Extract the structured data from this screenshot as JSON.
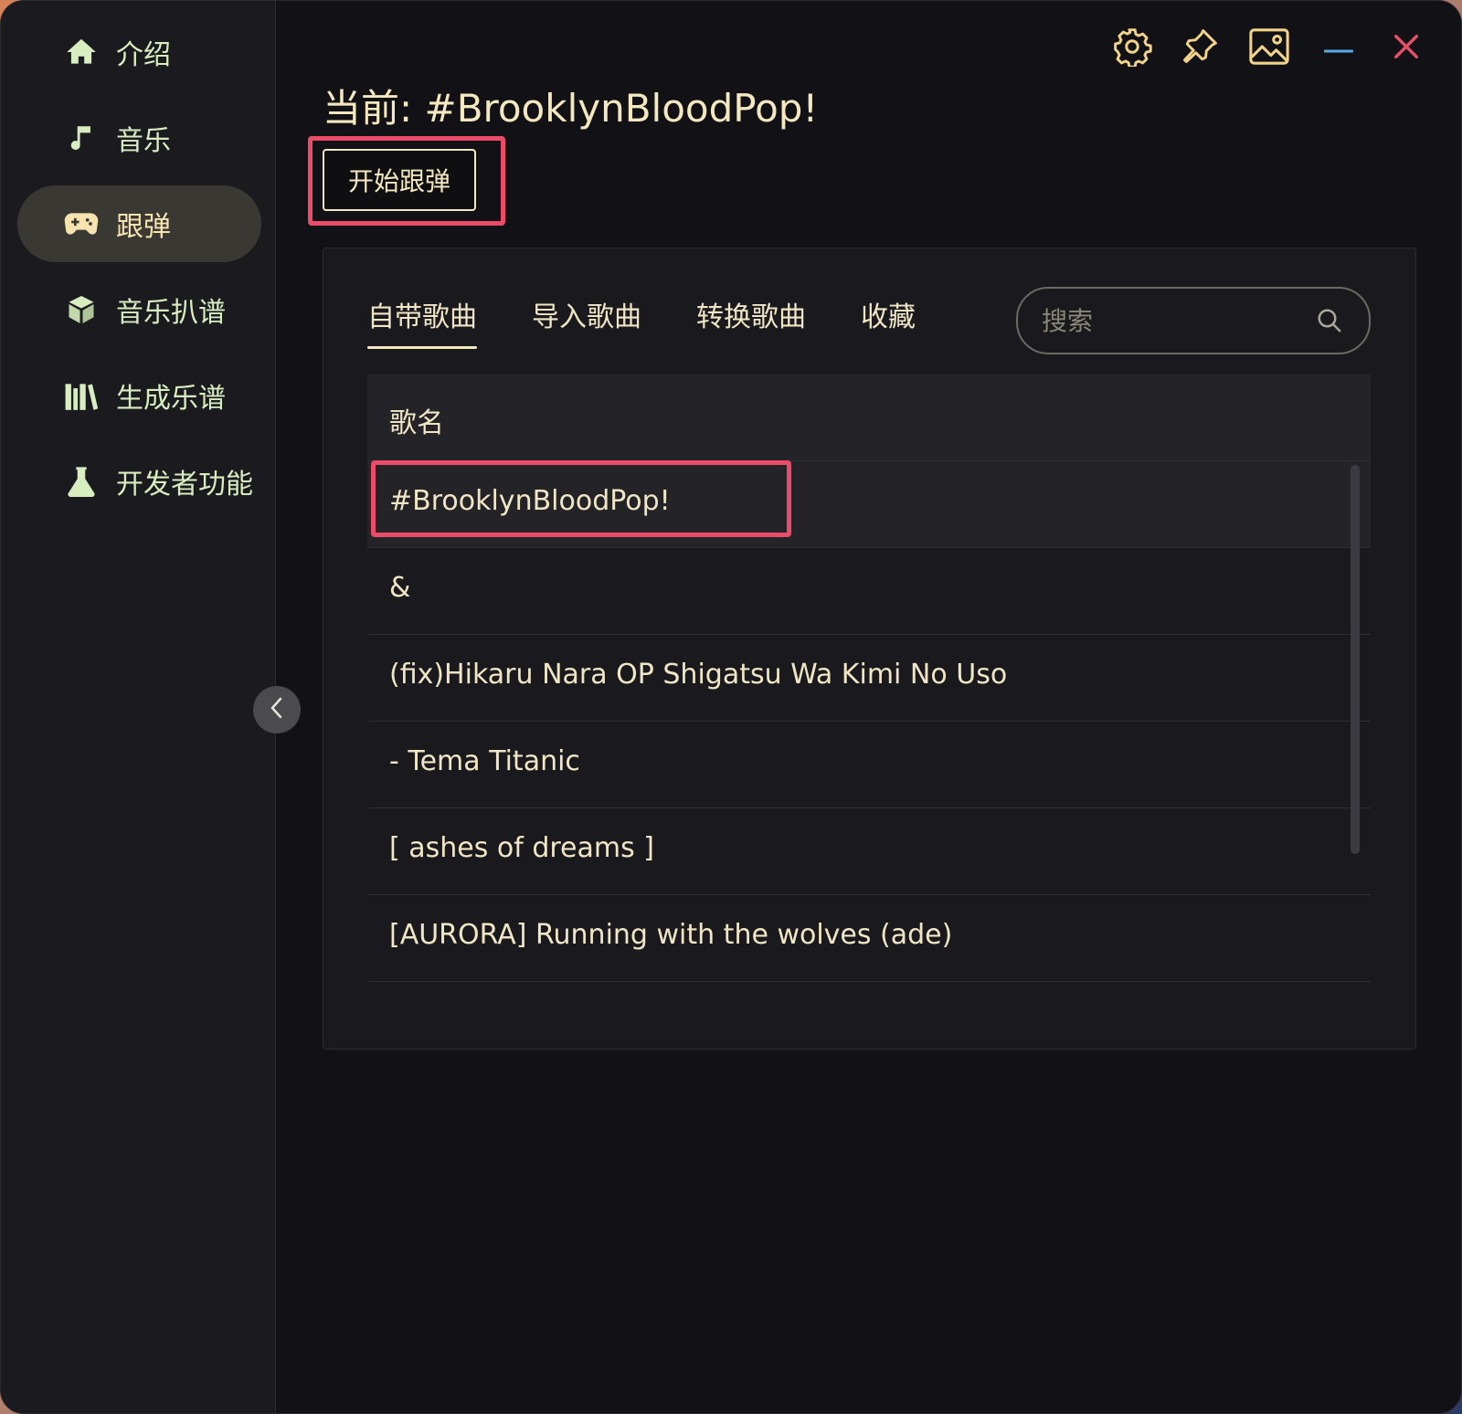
{
  "sidebar": {
    "items": [
      {
        "label": "介绍",
        "icon": "home-icon"
      },
      {
        "label": "音乐",
        "icon": "music-note-icon"
      },
      {
        "label": "跟弹",
        "icon": "gamepad-icon"
      },
      {
        "label": "音乐扒谱",
        "icon": "cube-icon"
      },
      {
        "label": "生成乐谱",
        "icon": "library-icon"
      },
      {
        "label": "开发者功能",
        "icon": "flask-icon"
      }
    ],
    "active_index": 2
  },
  "topbar": {
    "icons": [
      "gear-icon",
      "pin-icon",
      "image-icon",
      "minimize-icon",
      "close-icon"
    ]
  },
  "main": {
    "current_title": "当前: #BrooklynBloodPop!",
    "start_button": "开始跟弹"
  },
  "tabs": [
    {
      "label": "自带歌曲",
      "active": true
    },
    {
      "label": "导入歌曲",
      "active": false
    },
    {
      "label": "转换歌曲",
      "active": false
    },
    {
      "label": "收藏",
      "active": false
    }
  ],
  "search": {
    "placeholder": "搜索"
  },
  "table": {
    "header": "歌名",
    "rows": [
      "#BrooklynBloodPop!",
      "&",
      "(fix)Hikaru Nara OP Shigatsu Wa Kimi No Uso",
      "- Tema Titanic",
      "[ ashes of dreams ]",
      "[AURORA] Running with the wolves (ade)"
    ],
    "selected_index": 0
  },
  "colors": {
    "accent": "#f4e8c0",
    "highlight": "#ec4b6a",
    "close": "#e8506a",
    "minimize": "#5aa9e6"
  }
}
